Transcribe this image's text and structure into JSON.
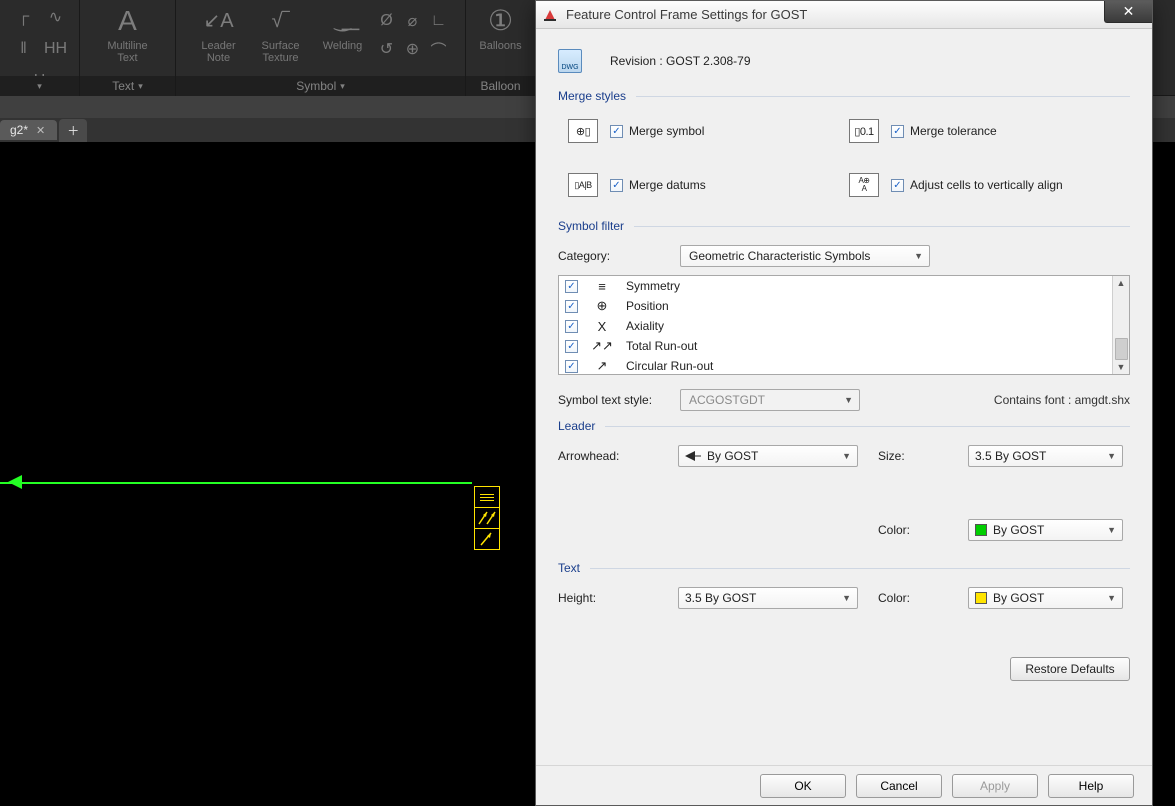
{
  "ribbon": {
    "panels": [
      {
        "label": "",
        "big": []
      },
      {
        "label": "Text",
        "big": [
          {
            "glyph": "A",
            "label": "Multiline\nText"
          }
        ]
      },
      {
        "label": "Symbol",
        "big": [
          {
            "glyph": "↙A",
            "label": "Leader\nNote"
          },
          {
            "glyph": "√‾",
            "label": "Surface\nTexture"
          },
          {
            "glyph": "⟯⟯",
            "label": "Welding"
          }
        ]
      },
      {
        "label": "Balloon",
        "big": [
          {
            "glyph": "①",
            "label": "Balloons"
          }
        ]
      }
    ]
  },
  "doc_tab": {
    "name": "g2*"
  },
  "dialog": {
    "title": "Feature Control Frame Settings for GOST",
    "revision": "Revision : GOST 2.308-79",
    "sections": {
      "merge": {
        "label": "Merge styles",
        "items": {
          "merge_symbol": {
            "label": "Merge symbol",
            "checked": true
          },
          "merge_tolerance": {
            "label": "Merge tolerance",
            "checked": true
          },
          "merge_datums": {
            "label": "Merge datums",
            "checked": true
          },
          "adjust_cells": {
            "label": "Adjust cells to vertically align",
            "checked": true
          }
        }
      },
      "filter": {
        "label": "Symbol filter",
        "category_label": "Category:",
        "category_value": "Geometric Characteristic Symbols",
        "items": [
          {
            "sym": "≡",
            "name": "Symmetry",
            "checked": true
          },
          {
            "sym": "⊕",
            "name": "Position",
            "checked": true
          },
          {
            "sym": "X",
            "name": "Axiality",
            "checked": true
          },
          {
            "sym": "↗↗",
            "name": "Total Run-out",
            "checked": true
          },
          {
            "sym": "↗",
            "name": "Circular Run-out",
            "checked": true
          }
        ],
        "style_label": "Symbol text style:",
        "style_value": "ACGOSTGDT",
        "font_note": "Contains font : amgdt.shx"
      },
      "leader": {
        "label": "Leader",
        "arrowhead_label": "Arrowhead:",
        "arrowhead_value": "By GOST",
        "size_label": "Size:",
        "size_value": "3.5  By GOST",
        "color_label": "Color:",
        "color_value": "By GOST"
      },
      "text": {
        "label": "Text",
        "height_label": "Height:",
        "height_value": "3.5  By GOST",
        "color_label": "Color:",
        "color_value": "By GOST"
      }
    },
    "buttons": {
      "restore": "Restore Defaults",
      "ok": "OK",
      "cancel": "Cancel",
      "apply": "Apply",
      "help": "Help"
    }
  }
}
